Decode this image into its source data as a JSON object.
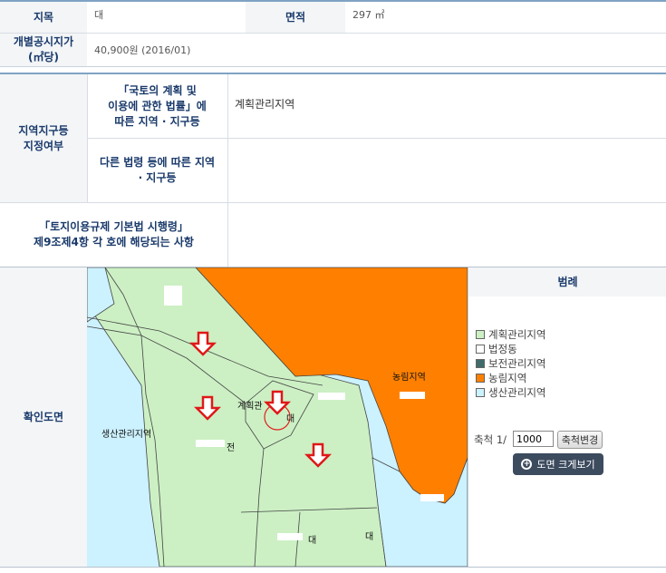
{
  "row1": {
    "jimok_label": "지목",
    "jimok_value": "대",
    "area_label": "면적",
    "area_value": "297 ㎡"
  },
  "row2": {
    "price_label_1": "개별공시지가",
    "price_label_2": "(㎡당)",
    "price_value": "40,900원 (2016/01)"
  },
  "zoning": {
    "header_1": "지역지구등",
    "header_2": "지정여부",
    "sub1_line1": "「국토의 계획 및",
    "sub1_line2": "이용에 관한 법률」에",
    "sub1_line3": "따른 지역 · 지구등",
    "sub1_value": "계획관리지역",
    "sub2_line1": "다른 법령 등에 따른 지역",
    "sub2_line2": "· 지구등",
    "sub2_value": ""
  },
  "regulation": {
    "line1": "「토지이용규제 기본법 시행령」",
    "line2": "제9조제4항 각 호에 해당되는 사항",
    "value": ""
  },
  "map": {
    "section_label": "확인도면",
    "labels": {
      "nongrim": "농림지역",
      "saengsan": "생산관리지역",
      "gyehoek": "계획관",
      "dae1": "대",
      "jeon": "전",
      "dae2": "대",
      "dae3": "대"
    },
    "legend_title": "범례",
    "legend": [
      {
        "label": "계획관리지역",
        "color": "#ccf0c4"
      },
      {
        "label": "법정동",
        "color": "#ffffff"
      },
      {
        "label": "보전관리지역",
        "color": "#3f6b6b"
      },
      {
        "label": "농림지역",
        "color": "#ff8000"
      },
      {
        "label": "생산관리지역",
        "color": "#ccf1ff"
      }
    ],
    "scale_label": "축척 1/",
    "scale_value": "1000",
    "scale_button": "축척변경",
    "enlarge_button": "도면 크게보기"
  }
}
